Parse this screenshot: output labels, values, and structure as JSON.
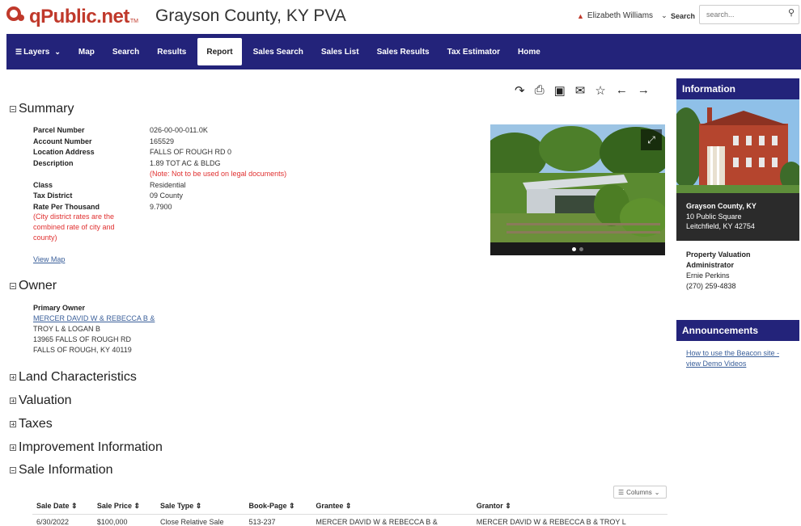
{
  "header": {
    "logo_text": "qPublic.net",
    "logo_tm": "TM",
    "site_title": "Grayson County, KY PVA",
    "user_name": "Elizabeth Williams",
    "search_label": "Search",
    "search_placeholder": "search..."
  },
  "nav": {
    "items": [
      {
        "label": "Layers",
        "has_menu": true
      },
      {
        "label": "Map"
      },
      {
        "label": "Search"
      },
      {
        "label": "Results"
      },
      {
        "label": "Report",
        "active": true
      },
      {
        "label": "Sales Search"
      },
      {
        "label": "Sales List"
      },
      {
        "label": "Sales Results"
      },
      {
        "label": "Tax Estimator"
      },
      {
        "label": "Home"
      }
    ]
  },
  "toolbar": {
    "icons": [
      "share-icon",
      "print-icon",
      "image-icon",
      "email-icon",
      "star-icon",
      "arrow-left-icon",
      "arrow-right-icon"
    ]
  },
  "summary": {
    "title": "Summary",
    "rows": [
      {
        "key": "Parcel Number",
        "value": "026-00-00-011.0K"
      },
      {
        "key": "Account Number",
        "value": "165529"
      },
      {
        "key": "Location Address",
        "value": "FALLS OF ROUGH RD 0"
      },
      {
        "key": "Description",
        "value": "1.89 TOT AC & BLDG",
        "note": "(Note: Not to be used on legal documents)"
      },
      {
        "key": "Class",
        "value": "Residential"
      },
      {
        "key": "Tax District",
        "value": "09 County"
      },
      {
        "key": "Rate Per Thousand",
        "value": "9.7900"
      }
    ],
    "city_note": "(City district rates are the combined rate of city and county)",
    "view_map": "View Map"
  },
  "owner": {
    "title": "Owner",
    "label": "Primary Owner",
    "name_link": "MERCER DAVID W & REBECCA B &",
    "lines": [
      "TROY L & LOGAN B",
      "13965 FALLS OF ROUGH RD",
      "FALLS OF ROUGH, KY 40119"
    ]
  },
  "collapsed_sections": [
    "Land Characteristics",
    "Valuation",
    "Taxes",
    "Improvement Information"
  ],
  "sale": {
    "title": "Sale Information",
    "columns_button": "Columns",
    "headers": [
      "Sale Date",
      "Sale Price",
      "Sale Type",
      "Book-Page",
      "Grantee",
      "Grantor"
    ],
    "rows": [
      [
        "6/30/2022",
        "$100,000",
        "Close Relative Sale",
        "513-237",
        "MERCER DAVID W & REBECCA B &",
        "MERCER DAVID W & REBECCA B & TROY L"
      ]
    ]
  },
  "sidebar": {
    "info_title": "Information",
    "county": "Grayson County, KY",
    "address1": "10 Public Square",
    "address2": "Leitchfield, KY 42754",
    "pva_title1": "Property Valuation",
    "pva_title2": "Administrator",
    "pva_name": "Ernie Perkins",
    "pva_phone": "(270) 259-4838",
    "announce_title": "Announcements",
    "announce_link": "How to use the Beacon site - view Demo Videos"
  },
  "colors": {
    "brand_red": "#c0392b",
    "nav_blue": "#23237a",
    "link_blue": "#3a5f9a",
    "note_red": "#e03030"
  }
}
